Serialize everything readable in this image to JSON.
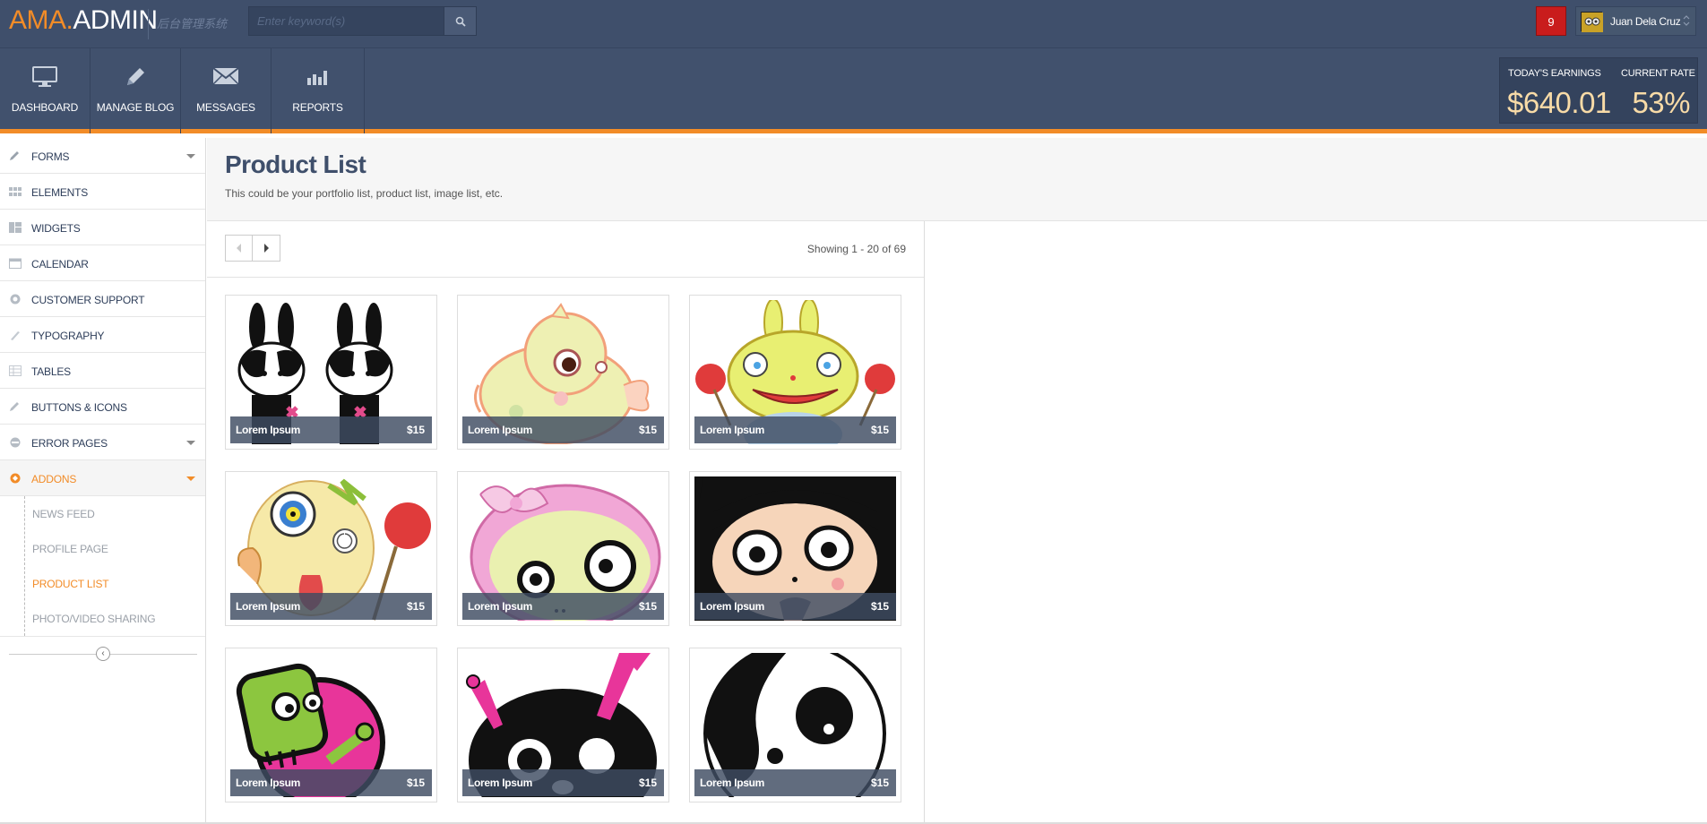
{
  "brand": {
    "part1": "AMA.",
    "part2": "ADMIN",
    "subtitle": "后台管理系统"
  },
  "search": {
    "placeholder": "Enter keyword(s)"
  },
  "notifications": {
    "count": "9"
  },
  "user": {
    "name": "Juan Dela Cruz"
  },
  "nav": [
    {
      "label": "DASHBOARD",
      "icon": "monitor-icon"
    },
    {
      "label": "MANAGE BLOG",
      "icon": "pencil-icon"
    },
    {
      "label": "MESSAGES",
      "icon": "envelope-icon"
    },
    {
      "label": "REPORTS",
      "icon": "bar-chart-icon"
    }
  ],
  "stats": {
    "earnings_label": "TODAY'S EARNINGS",
    "earnings_value": "$640.01",
    "rate_label": "CURRENT RATE",
    "rate_value": "53%"
  },
  "sidebar": {
    "items": [
      {
        "label": "FORMS",
        "icon": "pencil-icon",
        "caret": true
      },
      {
        "label": "ELEMENTS",
        "icon": "grid-icon"
      },
      {
        "label": "WIDGETS",
        "icon": "widgets-icon"
      },
      {
        "label": "CALENDAR",
        "icon": "calendar-icon"
      },
      {
        "label": "CUSTOMER SUPPORT",
        "icon": "lifebuoy-icon"
      },
      {
        "label": "TYPOGRAPHY",
        "icon": "brush-icon"
      },
      {
        "label": "TABLES",
        "icon": "table-icon"
      },
      {
        "label": "BUTTONS & ICONS",
        "icon": "pencil-icon"
      },
      {
        "label": "ERROR PAGES",
        "icon": "block-icon",
        "caret": true
      },
      {
        "label": "ADDONS",
        "icon": "addons-icon",
        "caret": true,
        "active": true
      }
    ],
    "subitems": [
      {
        "label": "NEWS FEED"
      },
      {
        "label": "PROFILE PAGE"
      },
      {
        "label": "PRODUCT LIST",
        "current": true
      },
      {
        "label": "PHOTO/VIDEO SHARING"
      }
    ]
  },
  "page": {
    "title": "Product List",
    "description": "This could be your portfolio list, product list, image list, etc."
  },
  "listing": {
    "showing": "Showing 1 - 20 of 69"
  },
  "products": [
    {
      "name": "Lorem Ipsum",
      "price": "$15",
      "art": "bunnies"
    },
    {
      "name": "Lorem Ipsum",
      "price": "$15",
      "art": "pig"
    },
    {
      "name": "Lorem Ipsum",
      "price": "$15",
      "art": "frog"
    },
    {
      "name": "Lorem Ipsum",
      "price": "$15",
      "art": "crazy"
    },
    {
      "name": "Lorem Ipsum",
      "price": "$15",
      "art": "bow"
    },
    {
      "name": "Lorem Ipsum",
      "price": "$15",
      "art": "devil"
    },
    {
      "name": "Lorem Ipsum",
      "price": "$15",
      "art": "zombie"
    },
    {
      "name": "Lorem Ipsum",
      "price": "$15",
      "art": "skull"
    },
    {
      "name": "Lorem Ipsum",
      "price": "$15",
      "art": "panda"
    }
  ],
  "colors": {
    "accent": "#f28c28",
    "navy": "#3f4f6b",
    "danger": "#c91c1c"
  }
}
